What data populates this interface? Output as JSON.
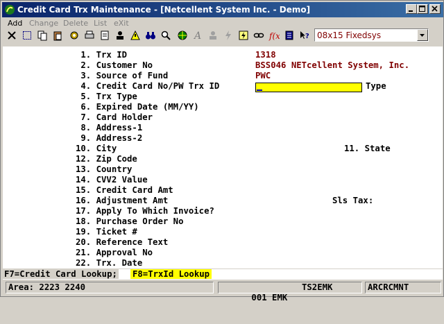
{
  "window": {
    "title": "Credit Card Trx Maintenance - [Netcellent System Inc. - Demo]"
  },
  "menu": {
    "add": "Add",
    "change": "Change",
    "delete": "Delete",
    "list": "List",
    "exit": "eXit"
  },
  "toolbar": {
    "font_value": "08x15 Fixedsys"
  },
  "form": {
    "fields": [
      {
        "label": " 1. Trx ID",
        "value": "1318"
      },
      {
        "label": " 2. Customer No",
        "value": "BSS046 NETcellent System, Inc."
      },
      {
        "label": " 3. Source of Fund",
        "value": "PWC"
      },
      {
        "label": " 4. Credit Card No/PW Trx ID",
        "value": ""
      },
      {
        "label": " 5. Trx Type",
        "value": ""
      },
      {
        "label": " 6. Expired Date (MM/YY)",
        "value": ""
      },
      {
        "label": " 7. Card Holder",
        "value": ""
      },
      {
        "label": " 8. Address-1",
        "value": ""
      },
      {
        "label": " 9. Address-2",
        "value": ""
      },
      {
        "label": "10. City",
        "value": ""
      },
      {
        "label": "12. Zip Code",
        "value": ""
      },
      {
        "label": "13. Country",
        "value": ""
      },
      {
        "label": "14. CVV2 Value",
        "value": ""
      },
      {
        "label": "15. Credit Card Amt",
        "value": ""
      },
      {
        "label": "16. Adjustment Amt",
        "value": ""
      },
      {
        "label": "17. Apply To Which Invoice?",
        "value": ""
      },
      {
        "label": "18. Purchase Order No",
        "value": ""
      },
      {
        "label": "19. Ticket #",
        "value": ""
      },
      {
        "label": "20. Reference Text",
        "value": ""
      },
      {
        "label": "21. Approval No",
        "value": ""
      },
      {
        "label": "22. Trx. Date",
        "value": ""
      }
    ],
    "type_label": "Type",
    "state_label": "11. State",
    "sls_tax_label": "Sls Tax:"
  },
  "fkeys": {
    "f7": "F7=Credit Card Lookup;",
    "f8": "F8=TrxId Lookup"
  },
  "status": {
    "area": "Area: 2223 2240",
    "user": "001 EMK",
    "terminal": "TS2EMK",
    "program": "ARCRCMNT"
  }
}
